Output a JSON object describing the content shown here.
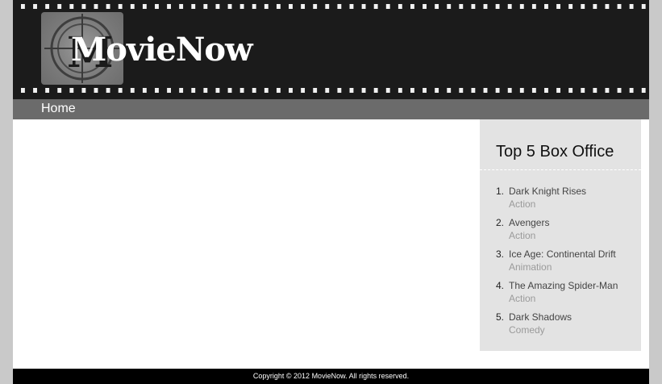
{
  "header": {
    "logo_text": "MovieNow"
  },
  "nav": {
    "home_label": "Home"
  },
  "sidebar": {
    "title": "Top 5 Box Office",
    "items": [
      {
        "rank": "1.",
        "title": "Dark Knight Rises",
        "genre": "Action"
      },
      {
        "rank": "2.",
        "title": "Avengers",
        "genre": "Action"
      },
      {
        "rank": "3.",
        "title": "Ice Age: Continental Drift",
        "genre": "Animation"
      },
      {
        "rank": "4.",
        "title": "The Amazing Spider-Man",
        "genre": "Action"
      },
      {
        "rank": "5.",
        "title": "Dark Shadows",
        "genre": "Comedy"
      }
    ]
  },
  "footer": {
    "copyright": "Copyright © 2012 MovieNow. All rights reserved."
  },
  "colors": {
    "header_bg": "#1b1b1b",
    "nav_bg": "#6b6b6b",
    "sidebar_bg": "#e3e3e3",
    "footer_bg": "#000000",
    "page_border": "#c9c9c9"
  }
}
